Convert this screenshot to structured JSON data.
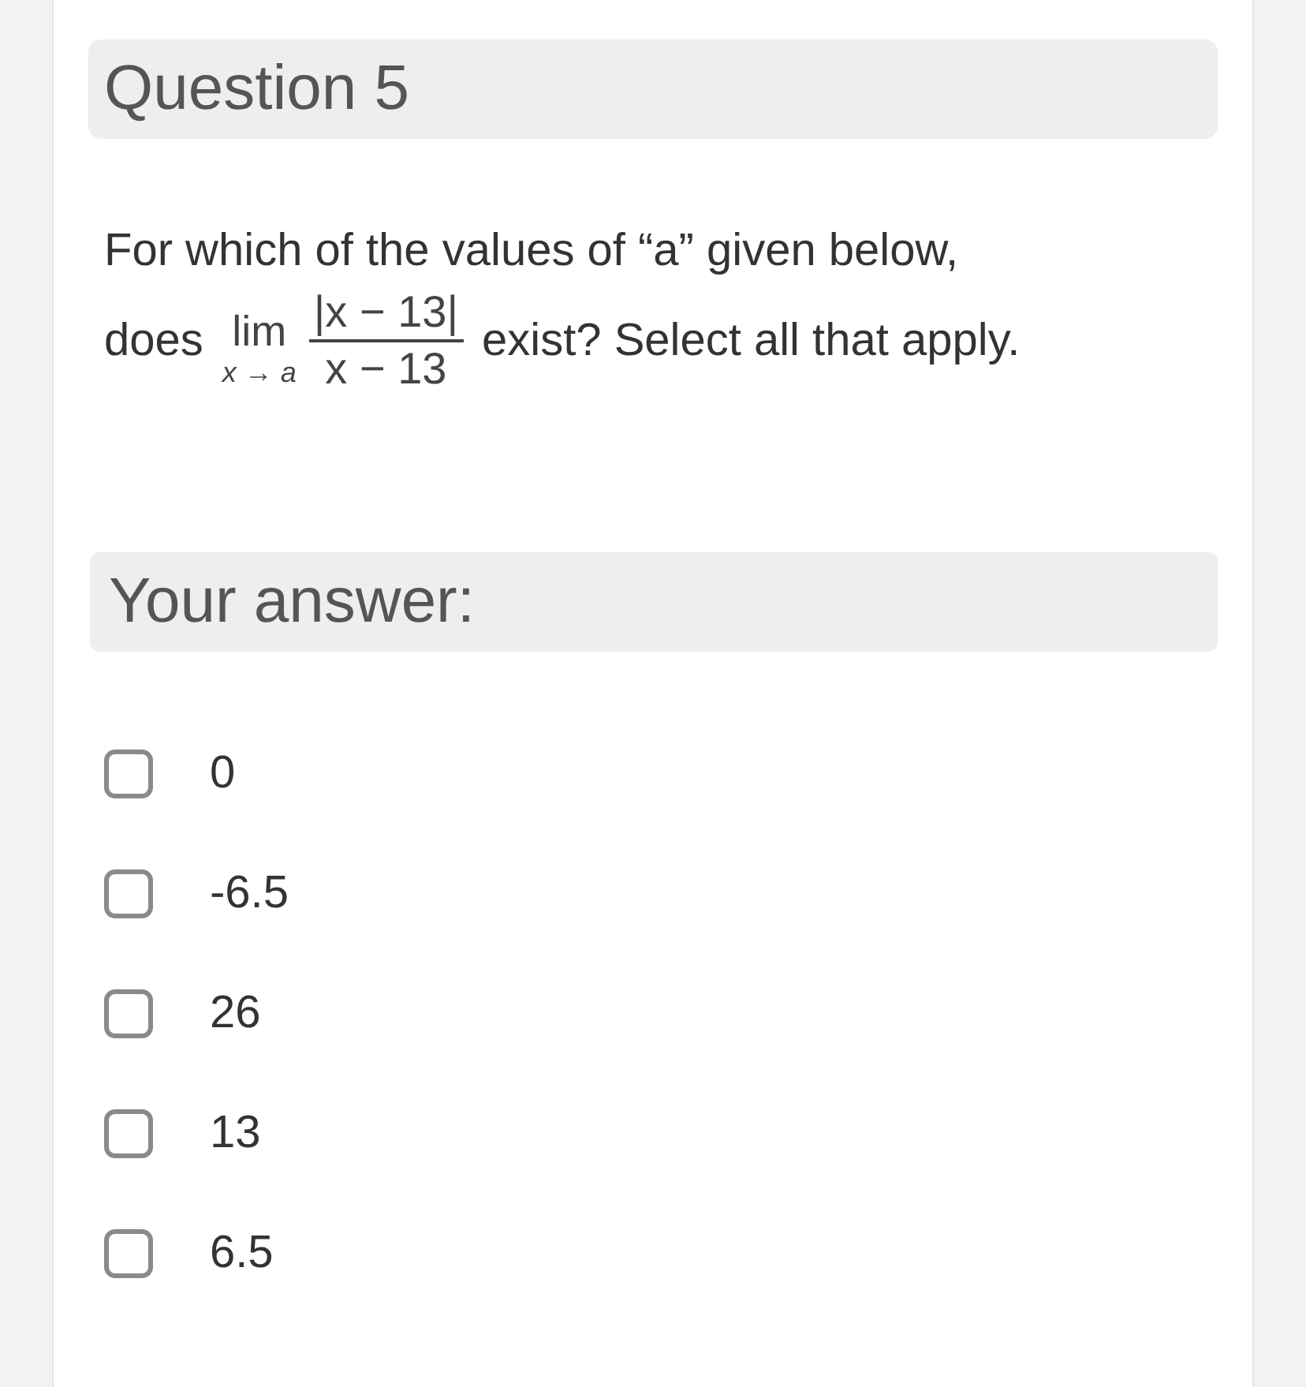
{
  "question": {
    "title": "Question 5",
    "prompt": {
      "line_1": "For which of the values of “a” given below,",
      "before": "does",
      "limit": "lim",
      "limit_under": "x → a",
      "numerator": "|x − 13|",
      "denominator": "x − 13",
      "after": "exist? Select all that apply."
    }
  },
  "answer": {
    "heading": "Your answer:",
    "options": [
      {
        "label": "0",
        "checked": false
      },
      {
        "label": "-6.5",
        "checked": false
      },
      {
        "label": "26",
        "checked": false
      },
      {
        "label": "13",
        "checked": false
      },
      {
        "label": "6.5",
        "checked": false
      }
    ]
  }
}
